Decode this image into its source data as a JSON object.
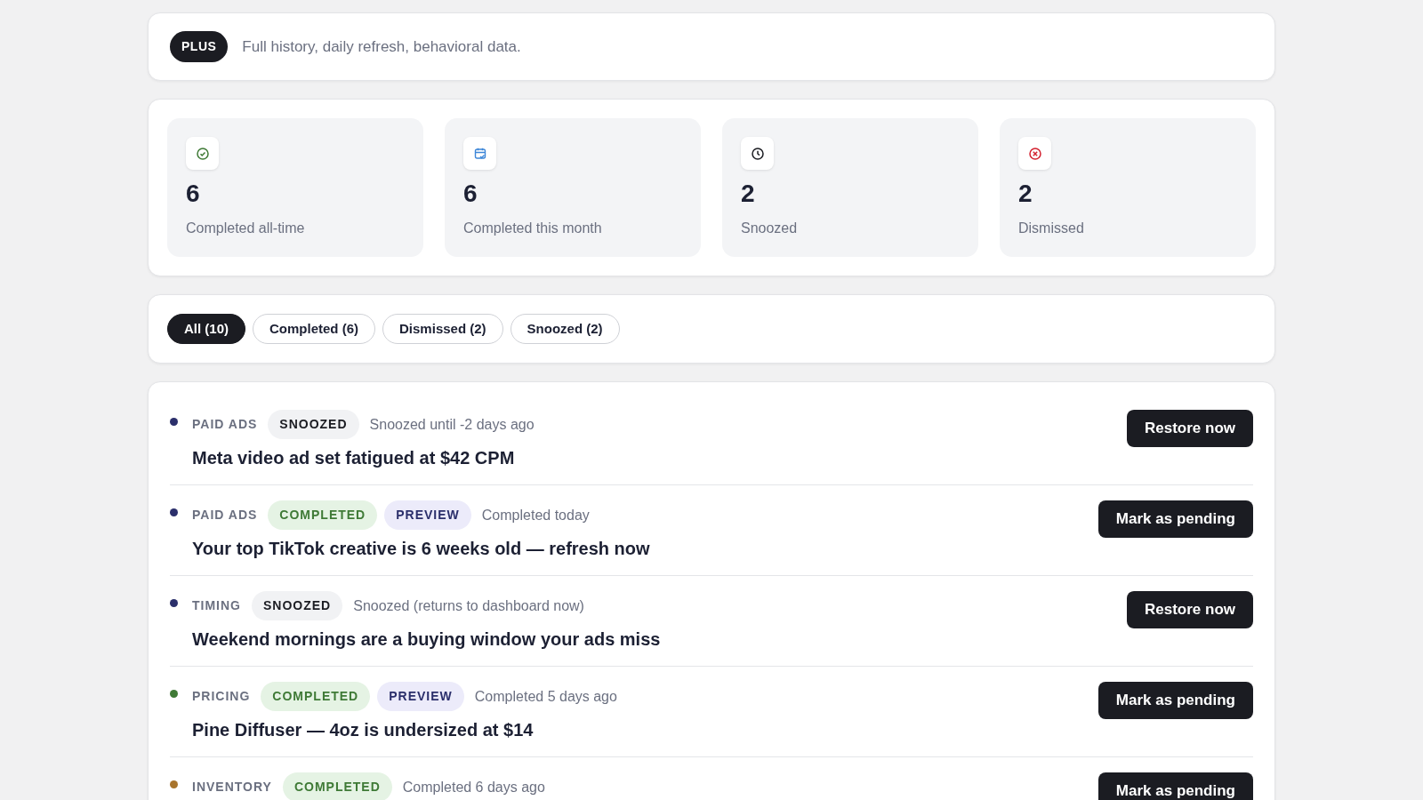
{
  "plan": {
    "badge": "PLUS",
    "description": "Full history, daily refresh, behavioral data."
  },
  "stats": [
    {
      "value": "6",
      "label": "Completed all-time"
    },
    {
      "value": "6",
      "label": "Completed this month"
    },
    {
      "value": "2",
      "label": "Snoozed"
    },
    {
      "value": "2",
      "label": "Dismissed"
    }
  ],
  "filters": [
    {
      "label": "All (10)",
      "selected": true
    },
    {
      "label": "Completed (6)",
      "selected": false
    },
    {
      "label": "Dismissed (2)",
      "selected": false
    },
    {
      "label": "Snoozed (2)",
      "selected": false
    }
  ],
  "items": [
    {
      "color": "#2b2f6b",
      "category": "PAID ADS",
      "tags": [
        {
          "kind": "snoozed",
          "label": "SNOOZED"
        }
      ],
      "note": "Snoozed until -2 days ago",
      "title": "Meta video ad set fatigued at $42 CPM",
      "action": "Restore now"
    },
    {
      "color": "#2b2f6b",
      "category": "PAID ADS",
      "tags": [
        {
          "kind": "completed",
          "label": "COMPLETED"
        },
        {
          "kind": "preview",
          "label": "PREVIEW"
        }
      ],
      "note": "Completed today",
      "title": "Your top TikTok creative is 6 weeks old — refresh now",
      "action": "Mark as pending"
    },
    {
      "color": "#2b2f6b",
      "category": "TIMING",
      "tags": [
        {
          "kind": "snoozed",
          "label": "SNOOZED"
        }
      ],
      "note": "Snoozed (returns to dashboard now)",
      "title": "Weekend mornings are a buying window your ads miss",
      "action": "Restore now"
    },
    {
      "color": "#3f7a36",
      "category": "PRICING",
      "tags": [
        {
          "kind": "completed",
          "label": "COMPLETED"
        },
        {
          "kind": "preview",
          "label": "PREVIEW"
        }
      ],
      "note": "Completed 5 days ago",
      "title": "Pine Diffuser — 4oz is undersized at $14",
      "action": "Mark as pending"
    },
    {
      "color": "#a8742c",
      "category": "INVENTORY",
      "tags": [
        {
          "kind": "completed",
          "label": "COMPLETED"
        }
      ],
      "note": "Completed 6 days ago",
      "action": "Mark as pending"
    }
  ]
}
